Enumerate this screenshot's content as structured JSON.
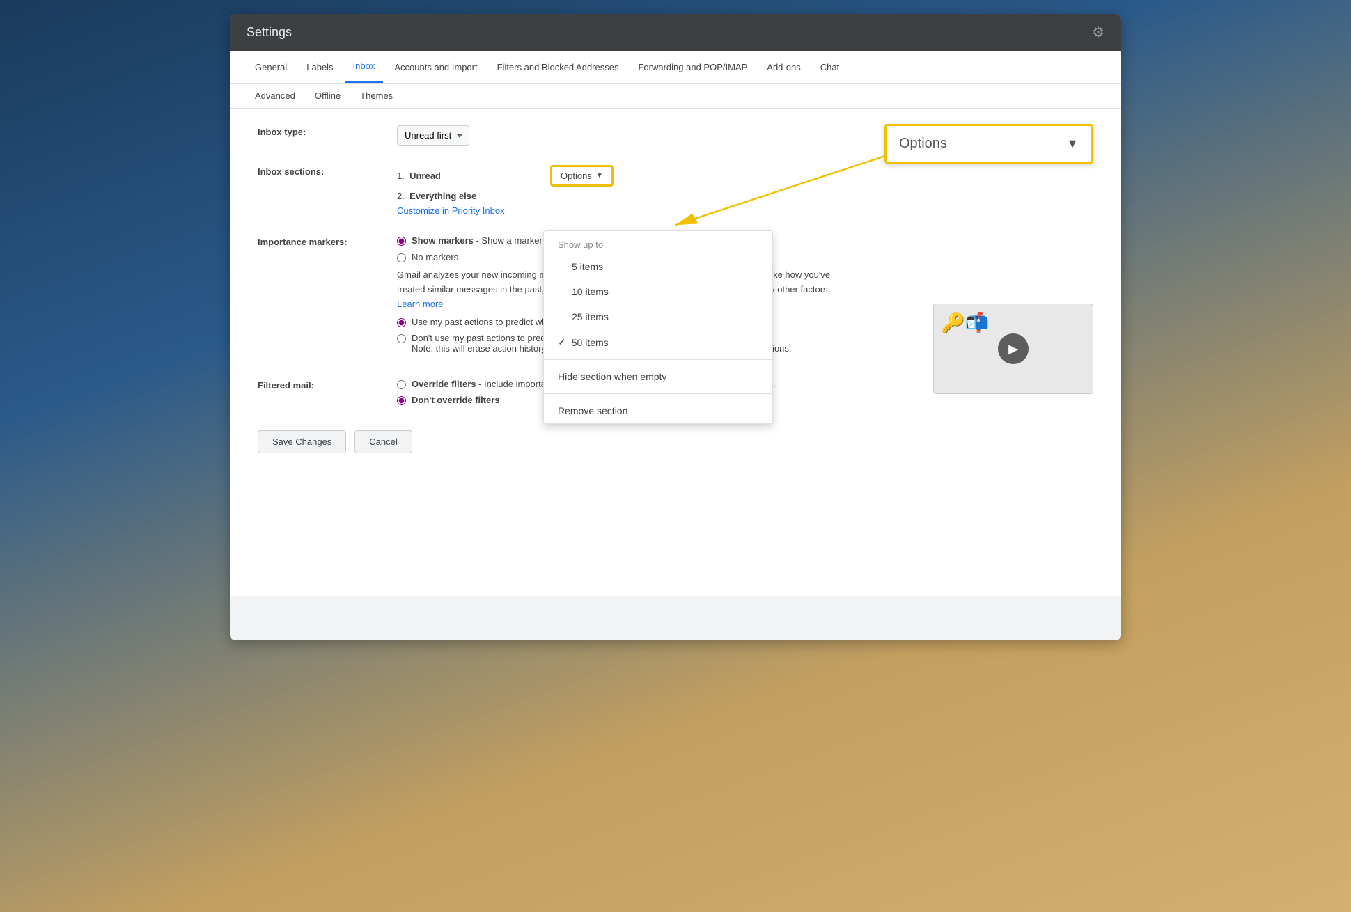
{
  "header": {
    "title": "Settings",
    "gear_label": "⚙"
  },
  "tabs_row1": [
    {
      "label": "General",
      "active": false
    },
    {
      "label": "Labels",
      "active": false
    },
    {
      "label": "Inbox",
      "active": true
    },
    {
      "label": "Accounts and Import",
      "active": false
    },
    {
      "label": "Filters and Blocked Addresses",
      "active": false
    },
    {
      "label": "Forwarding and POP/IMAP",
      "active": false
    },
    {
      "label": "Add-ons",
      "active": false
    },
    {
      "label": "Chat",
      "active": false
    }
  ],
  "tabs_row2": [
    {
      "label": "Advanced"
    },
    {
      "label": "Offline"
    },
    {
      "label": "Themes"
    }
  ],
  "inbox_type": {
    "label": "Inbox type:",
    "value": "Unread first"
  },
  "inbox_sections": {
    "label": "Inbox sections:",
    "section1": "1.",
    "section1_name": "Unread",
    "section2": "2.",
    "section2_name": "Everything else",
    "customize_link": "Customize in Priority Inbox",
    "options_label": "Options",
    "options_arrow": "▼"
  },
  "dropdown": {
    "show_up_to": "Show up to",
    "items": [
      {
        "label": "5 items",
        "checked": false
      },
      {
        "label": "10 items",
        "checked": false
      },
      {
        "label": "25 items",
        "checked": false
      },
      {
        "label": "50 items",
        "checked": true
      }
    ],
    "hide_section": "Hide section when empty",
    "remove_section": "Remove section"
  },
  "importance_markers": {
    "label": "Importance markers:",
    "option1_label": "Show markers",
    "option1_desc": " - Show a marker (",
    "option2_label": "No markers",
    "description": "Gmail analyzes your new incoming me... important, considering things like how in the past, how directly the message i other factors.",
    "learn_more": "Learn more",
    "radio1_label": "Use my past actions to predict whi...",
    "radio2_label": "Don't use my past actions to predict which messages are important.",
    "radio2_note": "Note: this will erase action history and will likely reduce the accuracy of importance predictions."
  },
  "filtered_mail": {
    "label": "Filtered mail:",
    "option1_label": "Override filters",
    "option1_desc": " - Include important messages in the inbox that may have been filtered out.",
    "option2_label": "Don't override filters"
  },
  "footer": {
    "save_label": "Save Changes",
    "cancel_label": "Cancel"
  },
  "callout": {
    "label": "Options",
    "arrow": "▼"
  }
}
